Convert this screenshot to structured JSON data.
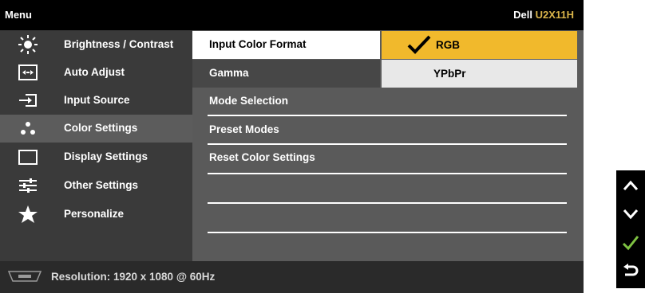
{
  "header": {
    "menu_label": "Menu",
    "brand": "Dell",
    "model": "U2X11H"
  },
  "sidebar": {
    "items": [
      {
        "label": "Brightness / Contrast",
        "icon": "brightness-icon"
      },
      {
        "label": "Auto Adjust",
        "icon": "auto-adjust-icon"
      },
      {
        "label": "Input Source",
        "icon": "input-source-icon"
      },
      {
        "label": "Color Settings",
        "icon": "color-settings-icon",
        "selected": true
      },
      {
        "label": "Display Settings",
        "icon": "display-settings-icon"
      },
      {
        "label": "Other Settings",
        "icon": "other-settings-icon"
      },
      {
        "label": "Personalize",
        "icon": "star-icon"
      }
    ]
  },
  "submenu": {
    "items": [
      {
        "label": "Input Color Format",
        "active": true
      },
      {
        "label": "Gamma"
      },
      {
        "label": "Mode Selection"
      },
      {
        "label": "Preset Modes"
      },
      {
        "label": "Reset Color Settings"
      }
    ]
  },
  "options": {
    "items": [
      {
        "label": "RGB",
        "selected": true
      },
      {
        "label": "YPbPr"
      }
    ],
    "selected_color": "#f1b92c"
  },
  "footer": {
    "input_icon": "vga-icon",
    "resolution": "Resolution: 1920 x 1080 @ 60Hz"
  },
  "keys": [
    "up-arrow-icon",
    "down-arrow-icon",
    "check-icon",
    "back-icon"
  ]
}
